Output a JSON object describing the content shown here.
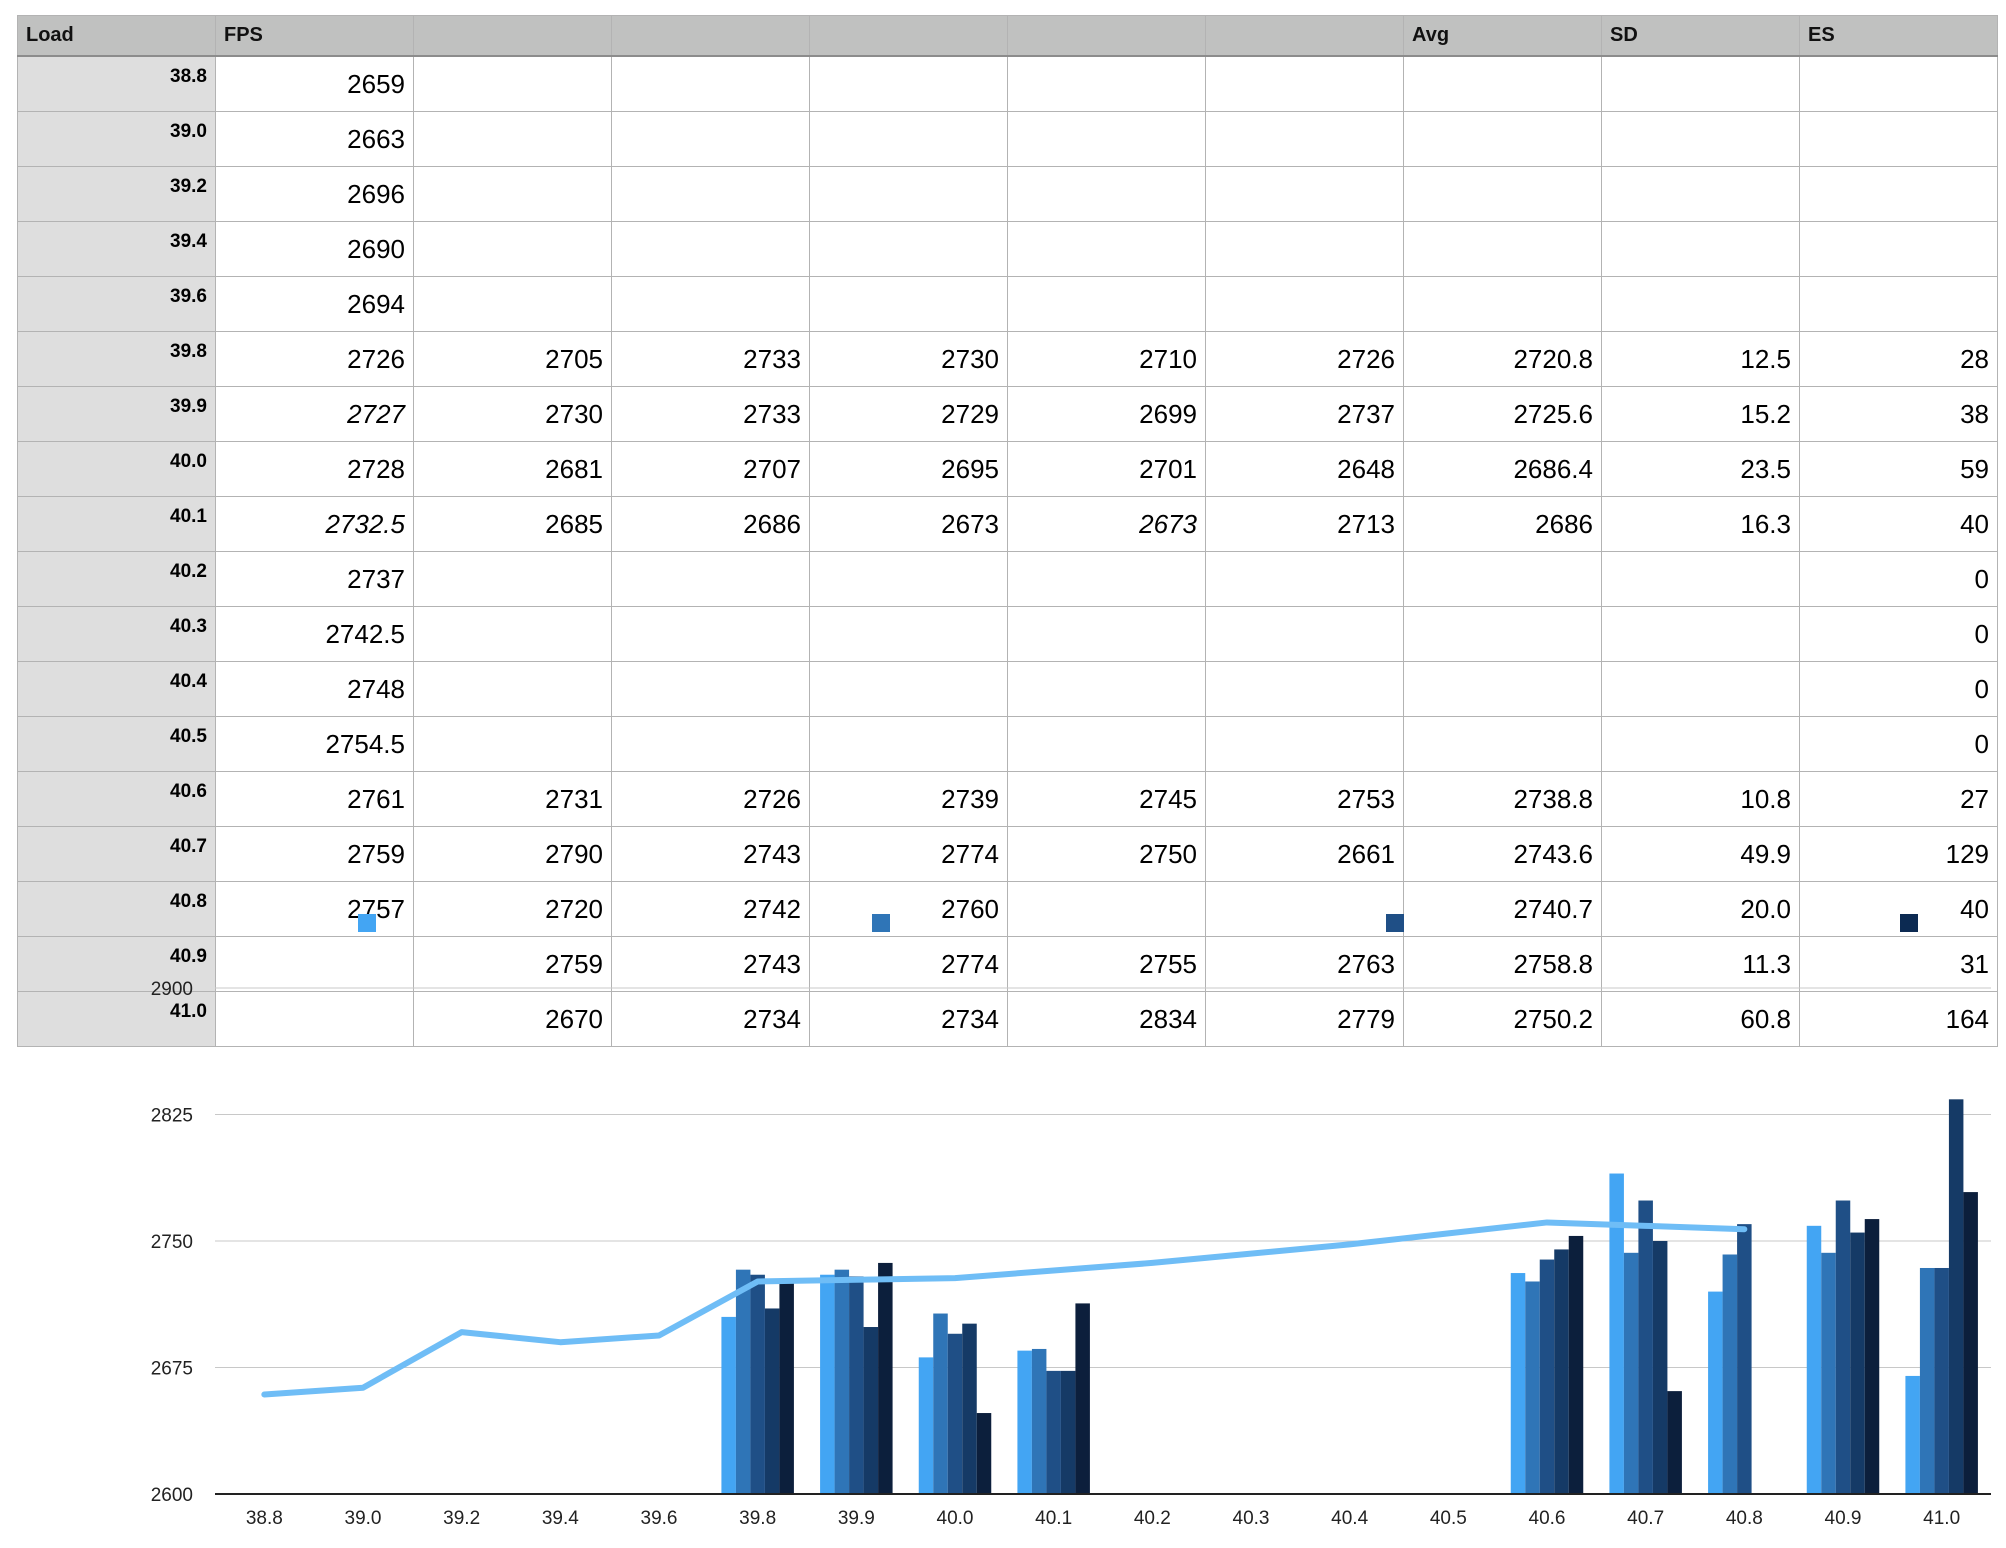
{
  "table": {
    "headers": [
      "Load",
      "FPS",
      "",
      "",
      "",
      "",
      "",
      "Avg",
      "SD",
      "ES"
    ],
    "rows": [
      [
        "38.8",
        "2659",
        "",
        "",
        "",
        "",
        "",
        "",
        "",
        ""
      ],
      [
        "39.0",
        "2663",
        "",
        "",
        "",
        "",
        "",
        "",
        "",
        ""
      ],
      [
        "39.2",
        "2696",
        "",
        "",
        "",
        "",
        "",
        "",
        "",
        ""
      ],
      [
        "39.4",
        "2690",
        "",
        "",
        "",
        "",
        "",
        "",
        "",
        ""
      ],
      [
        "39.6",
        "2694",
        "",
        "",
        "",
        "",
        "",
        "",
        "",
        ""
      ],
      [
        "39.8",
        "2726",
        "2705",
        "2733",
        "2730",
        "2710",
        "2726",
        "2720.8",
        "12.5",
        "28"
      ],
      [
        "39.9",
        "2727",
        "2730",
        "2733",
        "2729",
        "2699",
        "2737",
        "2725.6",
        "15.2",
        "38"
      ],
      [
        "40.0",
        "2728",
        "2681",
        "2707",
        "2695",
        "2701",
        "2648",
        "2686.4",
        "23.5",
        "59"
      ],
      [
        "40.1",
        "2732.5",
        "2685",
        "2686",
        "2673",
        "2673",
        "2713",
        "2686",
        "16.3",
        "40"
      ],
      [
        "40.2",
        "2737",
        "",
        "",
        "",
        "",
        "",
        "",
        "",
        "0"
      ],
      [
        "40.3",
        "2742.5",
        "",
        "",
        "",
        "",
        "",
        "",
        "",
        "0"
      ],
      [
        "40.4",
        "2748",
        "",
        "",
        "",
        "",
        "",
        "",
        "",
        "0"
      ],
      [
        "40.5",
        "2754.5",
        "",
        "",
        "",
        "",
        "",
        "",
        "",
        "0"
      ],
      [
        "40.6",
        "2761",
        "2731",
        "2726",
        "2739",
        "2745",
        "2753",
        "2738.8",
        "10.8",
        "27"
      ],
      [
        "40.7",
        "2759",
        "2790",
        "2743",
        "2774",
        "2750",
        "2661",
        "2743.6",
        "49.9",
        "129"
      ],
      [
        "40.8",
        "2757",
        "2720",
        "2742",
        "2760",
        "",
        "",
        "2740.7",
        "20.0",
        "40"
      ],
      [
        "40.9",
        "",
        "2759",
        "2743",
        "2774",
        "2755",
        "2763",
        "2758.8",
        "11.3",
        "31"
      ],
      [
        "41.0",
        "",
        "2670",
        "2734",
        "2734",
        "2834",
        "2779",
        "2750.2",
        "60.8",
        "164"
      ]
    ],
    "italic_cells": [
      [
        6,
        1
      ],
      [
        8,
        1
      ],
      [
        8,
        5
      ]
    ]
  },
  "chart_data": {
    "type": "bar",
    "categories": [
      "38.8",
      "39.0",
      "39.2",
      "39.4",
      "39.6",
      "39.8",
      "39.9",
      "40.0",
      "40.1",
      "40.2",
      "40.3",
      "40.4",
      "40.5",
      "40.6",
      "40.7",
      "40.8",
      "40.9",
      "41.0"
    ],
    "ylim": [
      2600,
      2900
    ],
    "yticks": [
      "2600",
      "2675",
      "2750",
      "2825",
      "2900"
    ],
    "grid": true,
    "legend_position": "top",
    "series": [
      {
        "type": "bar",
        "color": "#43a5f3",
        "values": [
          null,
          null,
          null,
          null,
          null,
          2705,
          2730,
          2681,
          2685,
          null,
          null,
          null,
          null,
          2731,
          2790,
          2720,
          2759,
          2670
        ]
      },
      {
        "type": "bar",
        "color": "#2f75b7",
        "values": [
          null,
          null,
          null,
          null,
          null,
          2733,
          2733,
          2707,
          2686,
          null,
          null,
          null,
          null,
          2726,
          2743,
          2742,
          2743,
          2734
        ]
      },
      {
        "type": "bar",
        "color": "#1f4f86",
        "values": [
          null,
          null,
          null,
          null,
          null,
          2730,
          2729,
          2695,
          2673,
          null,
          null,
          null,
          null,
          2739,
          2774,
          2760,
          2774,
          2734
        ]
      },
      {
        "type": "bar",
        "color": "#153a66",
        "values": [
          null,
          null,
          null,
          null,
          null,
          2710,
          2699,
          2701,
          2673,
          null,
          null,
          null,
          null,
          2745,
          2750,
          null,
          2755,
          2834
        ]
      },
      {
        "type": "bar",
        "color": "#0c1f3c",
        "values": [
          null,
          null,
          null,
          null,
          null,
          2726,
          2737,
          2648,
          2713,
          null,
          null,
          null,
          null,
          2753,
          2661,
          null,
          2763,
          2779
        ]
      },
      {
        "type": "line",
        "color": "#6fbdf6",
        "values": [
          2659,
          2663,
          2696,
          2690,
          2694,
          2726,
          2727,
          2728,
          2732.5,
          2737,
          2742.5,
          2748,
          2754.5,
          2761,
          2759,
          2757,
          null,
          null
        ]
      }
    ],
    "legend_colors": [
      "#43a5f3",
      "#2f75b7",
      "#1f4f86",
      "#0c2a52"
    ]
  }
}
